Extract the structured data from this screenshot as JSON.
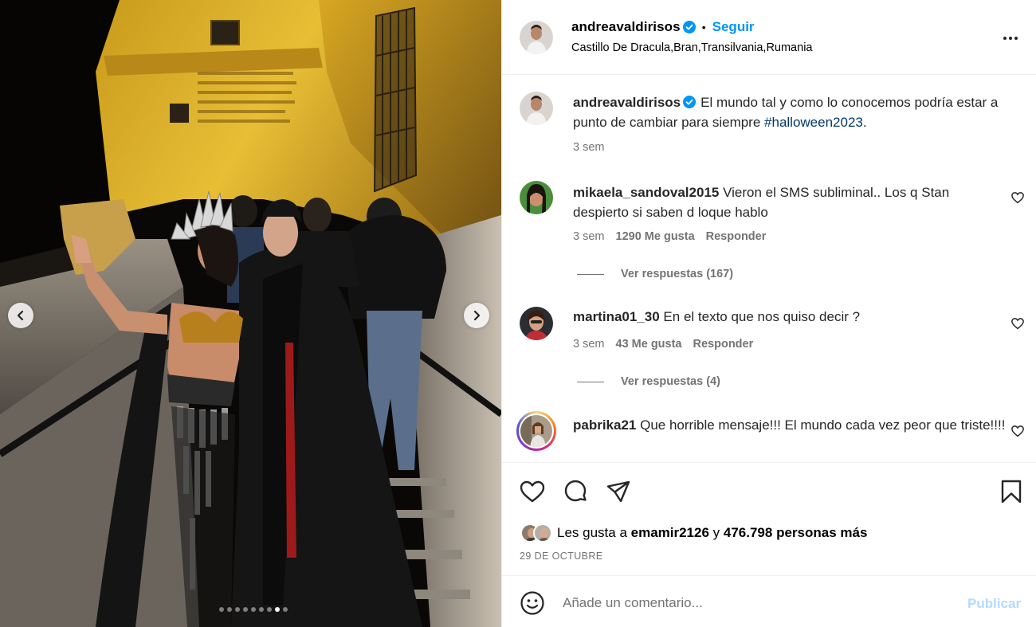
{
  "post": {
    "author": "andreavaldirisos",
    "follow_label": "Seguir",
    "separator": "•",
    "location": "Castillo De Dracula,Bran,Transilvania,Rumania",
    "caption_text": "El mundo tal y como lo conocemos podría estar a punto de cambiar para siempre ",
    "caption_hashtag": "#halloween2023",
    "caption_end": ".",
    "caption_time": "3 sem",
    "carousel": {
      "total": 9,
      "active": 8
    }
  },
  "comments": [
    {
      "user": "mikaela_sandoval2015",
      "text": "Vieron el SMS subliminal.. Los q Stan despierto si saben d loque hablo",
      "time": "3 sem",
      "likes": "1290 Me gusta",
      "reply": "Responder",
      "view_replies": "Ver respuestas (167)"
    },
    {
      "user": "martina01_30",
      "text": "En el texto que nos quiso decir ?",
      "time": "3 sem",
      "likes": "43 Me gusta",
      "reply": "Responder",
      "view_replies": "Ver respuestas (4)"
    },
    {
      "user": "pabrika21",
      "text": "Que horrible mensaje!!! El mundo cada vez peor que triste!!!!"
    }
  ],
  "likes": {
    "prefix": "Les gusta a ",
    "user": "emamir2126",
    "mid": " y ",
    "count": "476.798 personas más"
  },
  "date": "29 DE OCTUBRE",
  "add_comment": {
    "placeholder": "Añade un comentario...",
    "publish": "Publicar"
  },
  "icons": {
    "verified": "verified-badge-icon",
    "more": "more-options-icon",
    "like": "heart-icon",
    "comment": "comment-icon",
    "share": "share-icon",
    "save": "bookmark-icon",
    "emoji": "emoji-icon"
  },
  "colors": {
    "accent": "#0095f6",
    "verified": "#0095f6",
    "publish_disabled": "#b3dbff"
  }
}
